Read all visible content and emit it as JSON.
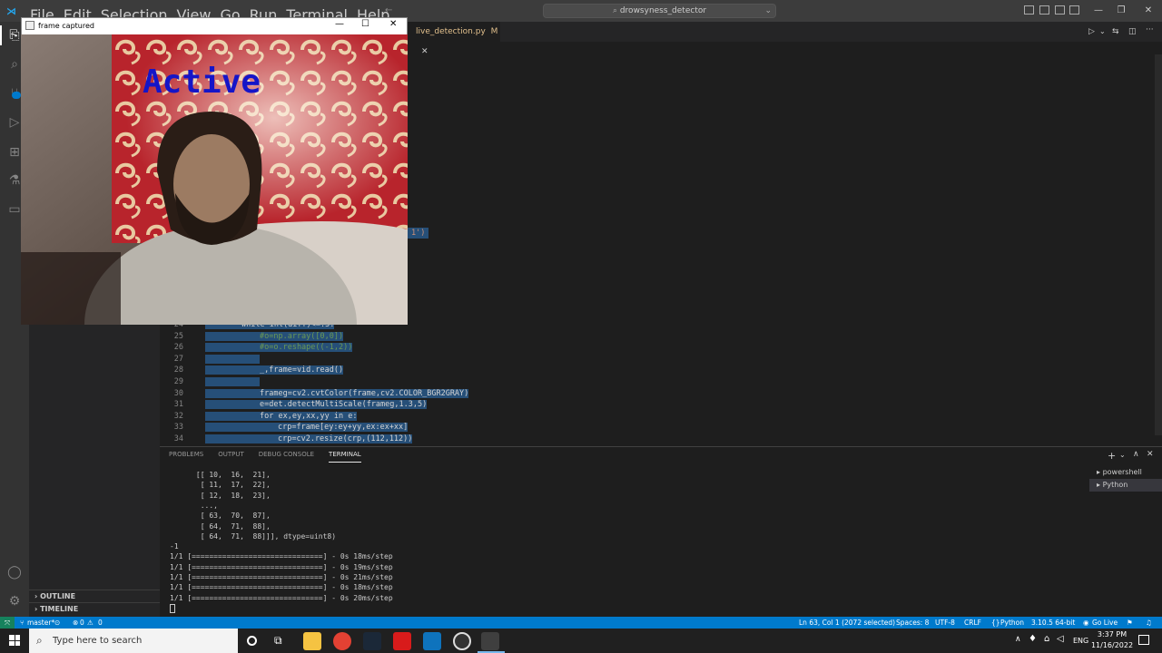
{
  "colors": {
    "statusbar": "#007acc",
    "titlebar": "#3c3c3c",
    "editor_bg": "#1e1e1e",
    "overlay_text": "#1515c8"
  },
  "menu": [
    "File",
    "Edit",
    "Selection",
    "View",
    "Go",
    "Run",
    "Terminal",
    "Help"
  ],
  "command_center": "drowsyness_detector",
  "editor": {
    "tab_label": "live_detection.py",
    "tab_status": "M",
    "partial_code_fragment": "1')",
    "lines": [
      {
        "n": "24",
        "indent": 2,
        "code": "while int(diff)<=.5:",
        "sel": true
      },
      {
        "n": "25",
        "indent": 3,
        "code": "#o=np.array([0,0])",
        "sel": true
      },
      {
        "n": "26",
        "indent": 3,
        "code": "#o=o.reshape((-1,2))",
        "sel": true
      },
      {
        "n": "27",
        "indent": 3,
        "code": "",
        "sel": true
      },
      {
        "n": "28",
        "indent": 3,
        "code": "_,frame=vid.read()",
        "sel": true
      },
      {
        "n": "29",
        "indent": 3,
        "code": "",
        "sel": true
      },
      {
        "n": "30",
        "indent": 3,
        "code": "frameg=cv2.cvtColor(frame,cv2.COLOR_BGR2GRAY)",
        "sel": true
      },
      {
        "n": "31",
        "indent": 3,
        "code": "e=det.detectMultiScale(frameg,1.3,5)",
        "sel": true
      },
      {
        "n": "32",
        "indent": 3,
        "code": "for ex,ey,xx,yy in e:",
        "sel": true
      },
      {
        "n": "33",
        "indent": 4,
        "code": "crp=frame[ey:ey+yy,ex:ex+xx]",
        "sel": true
      },
      {
        "n": "34",
        "indent": 4,
        "code": "crp=cv2.resize(crp,(112,112))",
        "sel": true
      }
    ]
  },
  "panel": {
    "tabs": [
      "PROBLEMS",
      "OUTPUT",
      "DEBUG CONSOLE",
      "TERMINAL"
    ],
    "active_tab": "TERMINAL",
    "terminals": [
      "powershell",
      "Python"
    ],
    "lines": [
      "      [[ 10,  16,  21],",
      "       [ 11,  17,  22],",
      "       [ 12,  18,  23],",
      "       ...,",
      "       [ 63,  70,  87],",
      "       [ 64,  71,  88],",
      "       [ 64,  71,  88]]], dtype=uint8)",
      "-1",
      "1/1 [==============================] - 0s 18ms/step",
      "1/1 [==============================] - 0s 19ms/step",
      "1/1 [==============================] - 0s 21ms/step",
      "1/1 [==============================] - 0s 18ms/step",
      "1/1 [==============================] - 0s 20ms/step"
    ]
  },
  "sidebar": {
    "outline": "OUTLINE",
    "timeline": "TIMELINE"
  },
  "statusbar": {
    "branch": "master*",
    "errors": "0",
    "warnings": "0",
    "position": "Ln 63, Col 1 (2072 selected)",
    "spaces": "Spaces: 8",
    "encoding": "UTF-8",
    "eol": "CRLF",
    "language": "Python",
    "interpreter": "3.10.5 64-bit",
    "golive": "Go Live"
  },
  "camera_window": {
    "title": "frame captured",
    "overlay_text": "Active"
  },
  "taskbar": {
    "search_placeholder": "Type here to search",
    "lang": "ENG",
    "time": "3:37 PM",
    "date": "11/16/2022"
  }
}
